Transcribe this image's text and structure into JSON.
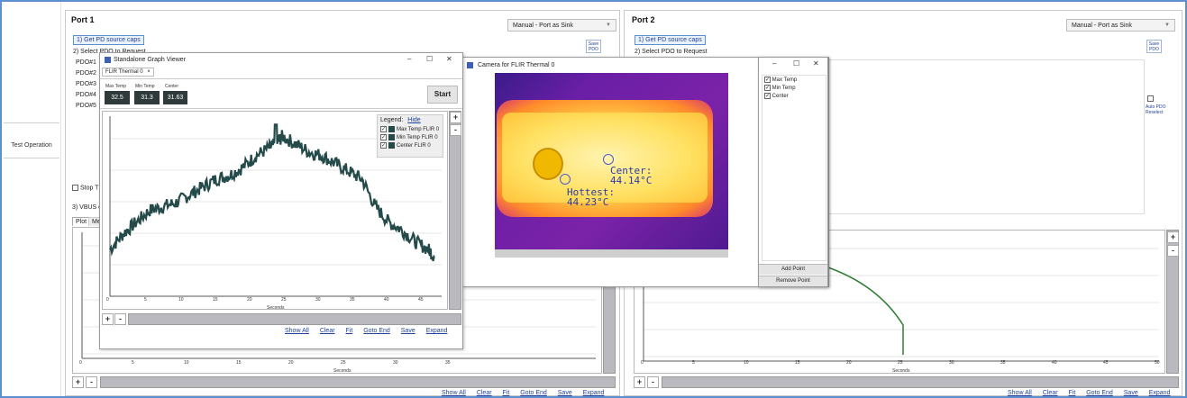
{
  "nav": {
    "test_operation": "Test Operation"
  },
  "port1": {
    "title": "Port 1",
    "mode": "Manual - Port as Sink",
    "get_caps": "1) Get PD source caps",
    "select_pdo": "2) Select PDO to Request",
    "save_pdo": "Save PDO",
    "pdos": [
      "PDO#1",
      "PDO#2",
      "PDO#3",
      "PDO#4",
      "PDO#5"
    ],
    "stop_label": "Stop T",
    "vbus_label": "3) VBUS c",
    "tab_plot": "Plot",
    "tab_me": "Me",
    "x_ticks": [
      "0",
      "5",
      "10",
      "15",
      "20",
      "25",
      "30",
      "35"
    ],
    "x_label": "Seconds",
    "links": [
      "Show All",
      "Clear",
      "Fit",
      "Goto End",
      "Save",
      "Expand"
    ]
  },
  "port2": {
    "title": "Port 2",
    "mode": "Manual - Port as Sink",
    "get_caps": "1) Get PD source caps",
    "select_pdo": "2) Select PDO to Request",
    "save_pdo": "Save PDO",
    "auto_pdo": "Auto PDO Reselect",
    "x_ticks": [
      "0",
      "5",
      "10",
      "15",
      "20",
      "25",
      "30",
      "35",
      "40",
      "45",
      "50"
    ],
    "x_label": "Seconds",
    "links": [
      "Show All",
      "Clear",
      "Fit",
      "Goto End",
      "Save",
      "Expand"
    ]
  },
  "graph_viewer": {
    "title": "Standalone Graph Viewer",
    "tab": "FLIR Thermal 0",
    "max_temp_label": "Max Temp",
    "min_temp_label": "Min Temp",
    "center_label": "Center",
    "max_temp": "32.5",
    "min_temp": "31.3",
    "center": "31.63",
    "start": "Start",
    "legend_title": "Legend:",
    "legend_hide": "Hide",
    "legend_items": [
      "Max Temp FLIR 0",
      "Min Temp FLIR 0",
      "Center FLIR 0"
    ],
    "x_ticks": [
      "0",
      "5",
      "10",
      "15",
      "20",
      "25",
      "30",
      "35",
      "40",
      "45"
    ],
    "x_label": "Seconds",
    "links": [
      "Show All",
      "Clear",
      "Fit",
      "Goto End",
      "Save",
      "Expand"
    ]
  },
  "camera": {
    "title": "Camera for FLIR Thermal 0",
    "center_label": "Center:",
    "center_value": "44.14°C",
    "hottest_label": "Hottest:",
    "hottest_value": "44.23°C"
  },
  "points_panel": {
    "items": [
      "Max Temp",
      "Min Temp",
      "Center"
    ],
    "add_point": "Add Point",
    "remove_point": "Remove Point"
  },
  "chart_data": {
    "type": "line",
    "x_label": "Seconds",
    "xlim": [
      0,
      50
    ],
    "series": [
      {
        "x": [
          0,
          2,
          4,
          6,
          8,
          10,
          12,
          14,
          16,
          18,
          20,
          22,
          24,
          25,
          26,
          28,
          30,
          32,
          34,
          36,
          38,
          40,
          42,
          44,
          46,
          48,
          49
        ],
        "y": [
          1.2,
          1.6,
          1.9,
          2.2,
          2.3,
          2.4,
          2.6,
          2.8,
          3.0,
          3.1,
          3.3,
          3.6,
          3.8,
          3.9,
          4.1,
          3.9,
          3.7,
          3.6,
          3.4,
          3.2,
          3.0,
          2.3,
          1.9,
          1.7,
          1.4,
          1.2,
          1.0
        ]
      }
    ]
  },
  "colors": {
    "accent": "#5b8fd0",
    "plot_line": "#254a4a",
    "port2_curve": "#2e7d32"
  }
}
